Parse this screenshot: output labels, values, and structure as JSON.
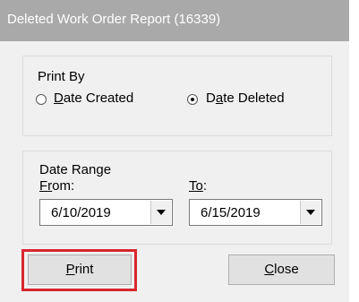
{
  "window": {
    "title": "Deleted Work Order Report (16339)"
  },
  "print_by": {
    "heading": "Print By",
    "option_created": {
      "first": "D",
      "rest": "ate Created",
      "selected": false
    },
    "option_deleted": {
      "first": "D",
      "u": "a",
      "rest": "te Deleted",
      "selected": true
    }
  },
  "date_range": {
    "heading": "Date Range",
    "from_label": {
      "first": "F",
      "u": "r",
      "rest": "om:"
    },
    "to_label": {
      "first": "T",
      "u": "o",
      "rest": ":"
    },
    "from_value": "6/10/2019",
    "to_value": "6/15/2019"
  },
  "buttons": {
    "print": {
      "u": "P",
      "rest": "rint"
    },
    "close": {
      "u": "C",
      "rest": "lose"
    }
  },
  "colors": {
    "highlight": "#d9262e",
    "titlebar": "#a9a9a9"
  }
}
